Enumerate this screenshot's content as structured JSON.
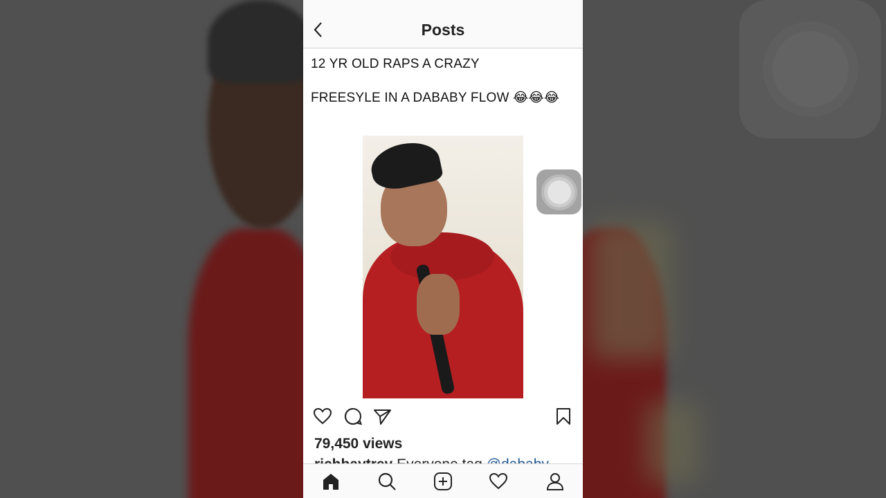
{
  "nav": {
    "title": "Posts"
  },
  "post": {
    "caption_line1": "12 YR OLD RAPS A CRAZY",
    "caption_line2": "FREESYLE IN A DABABY FLOW 😂😂😂",
    "views": "79,450 views",
    "comment_user": "richbaytrey",
    "comment_text": "Everyone tag",
    "comment_mention": "@dababy"
  },
  "icons": {
    "back": "chevron-left-icon",
    "like": "heart-icon",
    "comment": "comment-icon",
    "share": "paper-plane-icon",
    "save": "bookmark-icon",
    "tabs": [
      "home-icon",
      "search-icon",
      "add-post-icon",
      "activity-heart-icon",
      "profile-icon"
    ]
  },
  "colors": {
    "accent_link": "#1e5590",
    "hoodie": "#b51f22"
  }
}
